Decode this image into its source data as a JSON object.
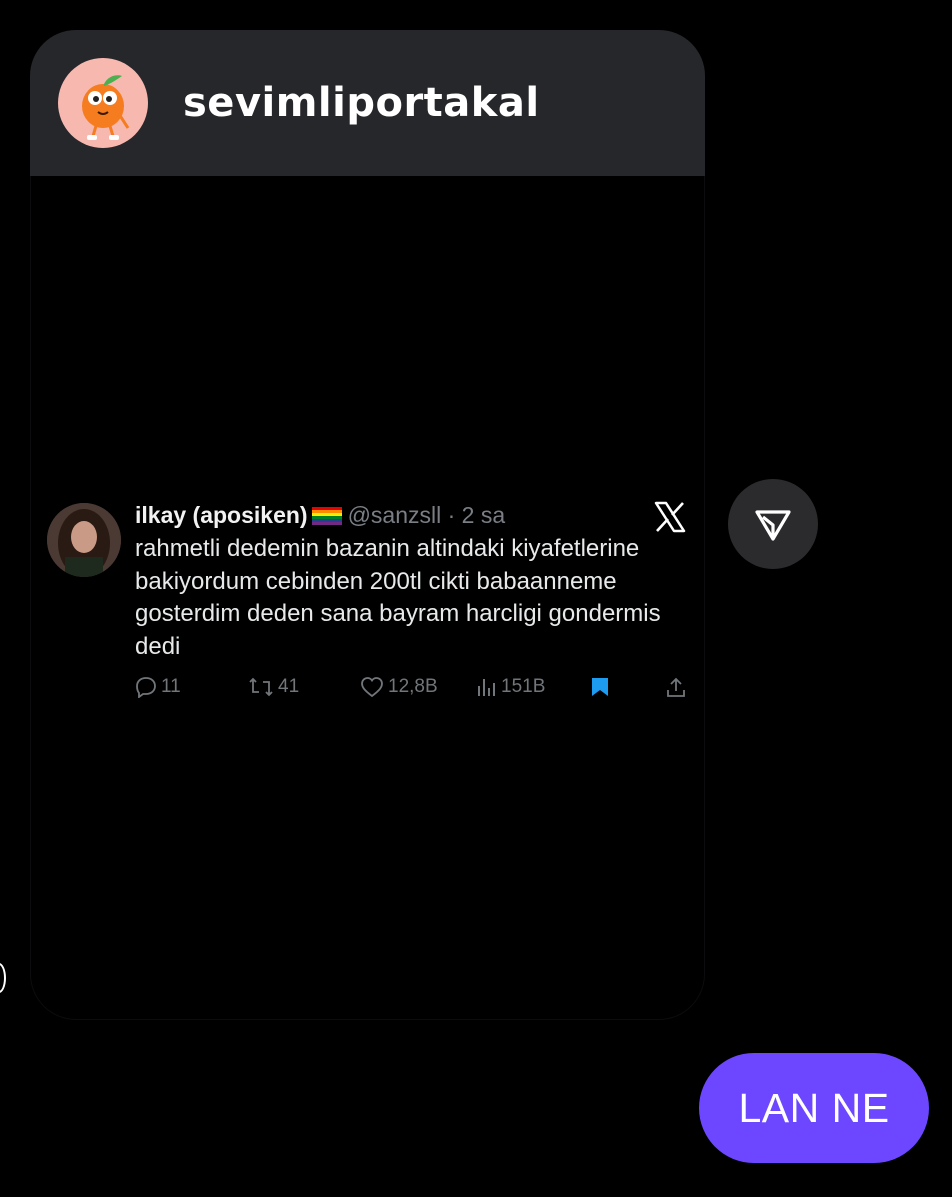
{
  "header": {
    "username": "sevimliportakal",
    "avatar_icon": "orange-mascot-icon"
  },
  "tweet": {
    "display_name": "ilkay (aposiken)",
    "flag_icon": "rainbow-flag-icon",
    "handle_time": "@sanzsll · 2 sa",
    "text": "rahmetli dedemin bazanin altindaki kiyafetlerine bakiyordum cebinden 200tl cikti babaanneme gosterdim deden sana bayram harcligi gondermis dedi",
    "platform_icon": "x-logo-icon",
    "actions": {
      "replies": "11",
      "retweets": "41",
      "likes": "12,8B",
      "views": "151B"
    },
    "colors": {
      "bookmark": "#1d9bf0",
      "muted": "#71767b"
    }
  },
  "send_icon": "send-icon",
  "message": {
    "text": "LAN NE",
    "bubble_color": "#6c47ff"
  }
}
